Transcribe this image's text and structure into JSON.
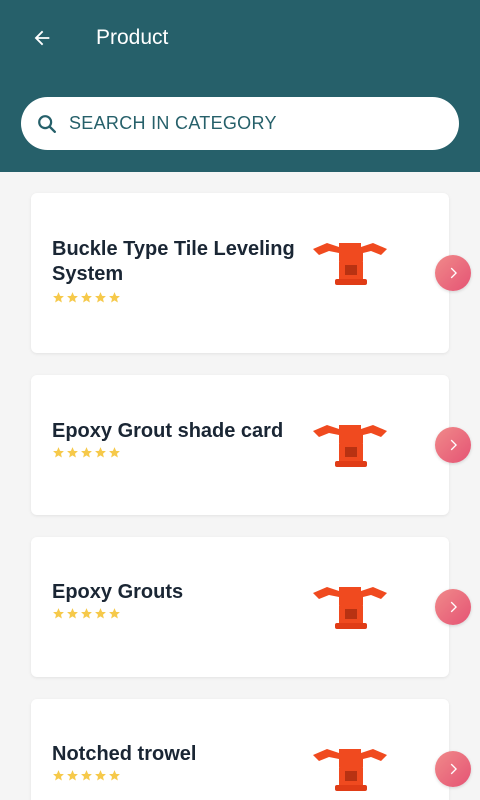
{
  "header": {
    "title": "Product",
    "back_icon": "arrow-left-icon",
    "background": "#26606a"
  },
  "search": {
    "placeholder": "SEARCH IN CATEGORY",
    "value": "",
    "icon": "search-icon"
  },
  "products": [
    {
      "name": "Buckle Type Tile Leveling System",
      "rating": 5
    },
    {
      "name": "Epoxy Grout shade card",
      "rating": 5
    },
    {
      "name": "Epoxy Grouts",
      "rating": 5
    },
    {
      "name": "Notched trowel",
      "rating": 5
    }
  ],
  "colors": {
    "star": "#f6c94a",
    "arrow_button_start": "#f08a8a",
    "arrow_button_end": "#e55374",
    "product_image": "#f04a1f"
  }
}
